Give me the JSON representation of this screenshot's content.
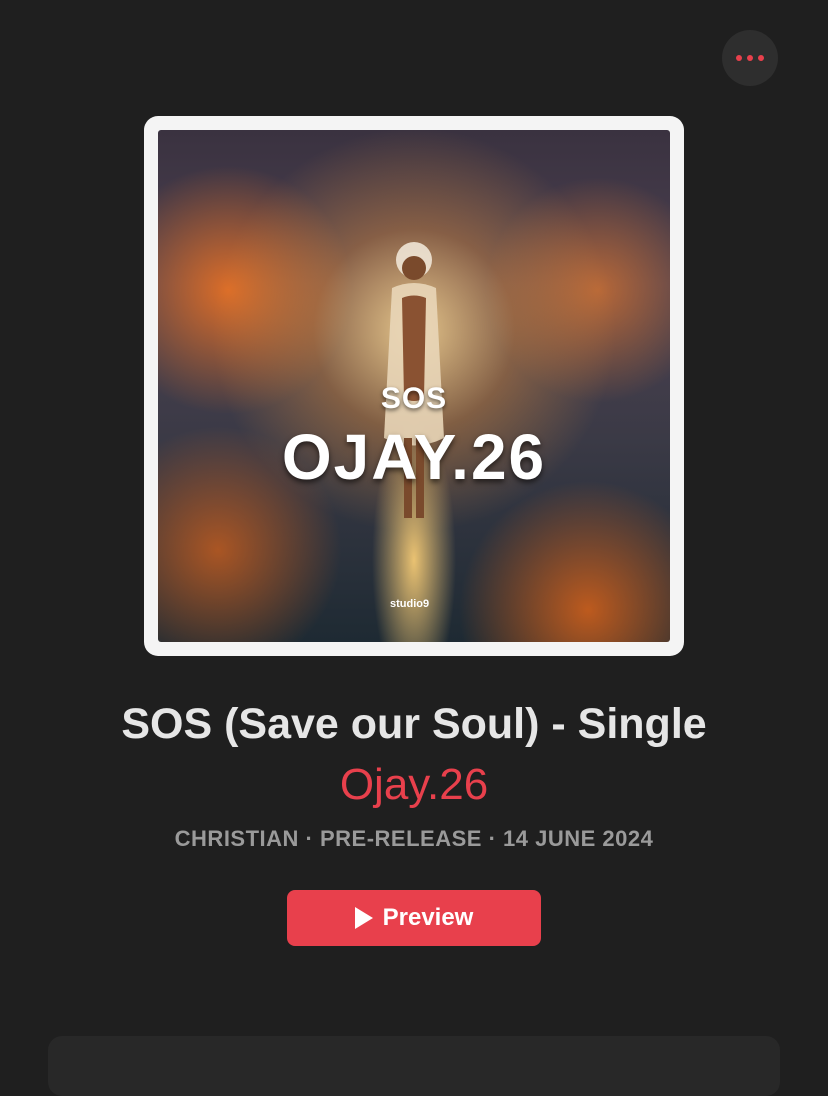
{
  "header": {
    "more_icon": "ellipsis-icon",
    "accent_color": "#e8404c"
  },
  "artwork": {
    "title_text": "SOS",
    "artist_text": "OJAY.26",
    "studio_text": "studio9"
  },
  "release": {
    "title": "SOS (Save our Soul) - Single",
    "artist": "Ojay.26",
    "meta": "CHRISTIAN · PRE-RELEASE · 14 JUNE 2024"
  },
  "actions": {
    "preview_label": "Preview",
    "preview_icon": "play-icon"
  }
}
